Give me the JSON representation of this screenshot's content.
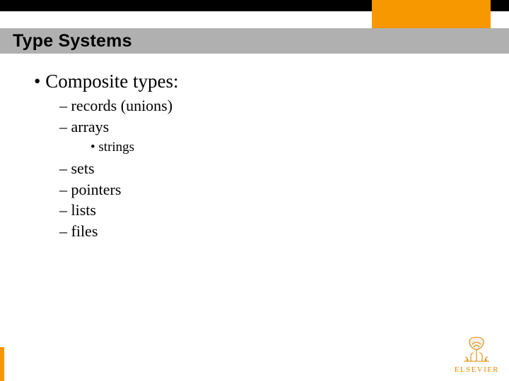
{
  "colors": {
    "accent": "#f79800",
    "titlebar": "#b0b0b0",
    "topbar": "#000000",
    "logo": "#e58a00"
  },
  "title": "Type Systems",
  "bullets": {
    "main": "Composite types:",
    "sub": {
      "records": "records (unions)",
      "arrays": "arrays",
      "strings": "strings",
      "sets": "sets",
      "pointers": "pointers",
      "lists": "lists",
      "files": "files"
    }
  },
  "logo_label": "ELSEVIER"
}
